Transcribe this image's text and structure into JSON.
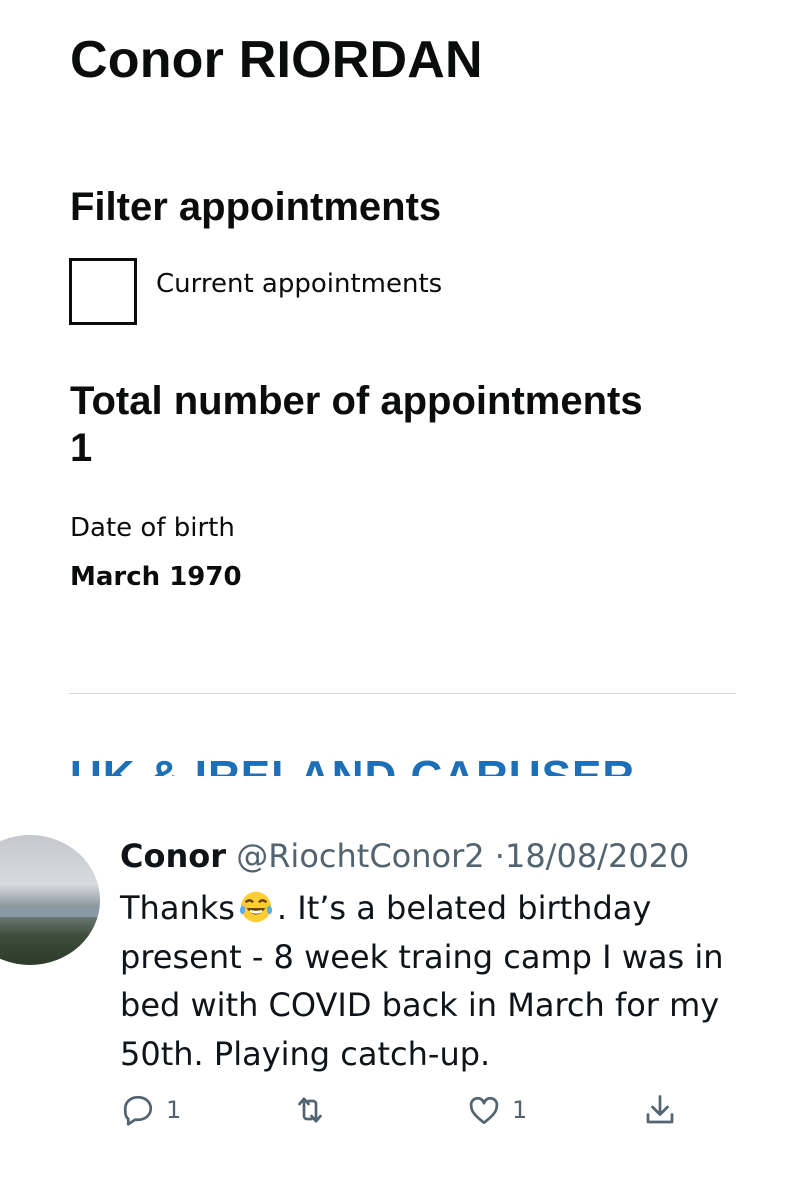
{
  "profile": {
    "name": "Conor RIORDAN",
    "filter_heading": "Filter appointments",
    "filter_checkbox_label": "Current appointments",
    "total_heading": "Total number of appointments",
    "total_count": "1",
    "dob_label": "Date of birth",
    "dob_value": "March 1970",
    "clipped_heading": "UK & IRELAND CARUSER"
  },
  "tweet": {
    "display_name": "Conor",
    "handle": "@RiochtConor2",
    "separator": "·",
    "date": "18/08/2020",
    "text_before_emoji": "Thanks",
    "emoji": "face-with-tears-of-joy",
    "text_after_emoji": ". It’s a belated birthday present - 8 week traing camp I was in bed with COVID back in March for my 50th. Playing catch-up.",
    "reply_count": "1",
    "like_count": "1"
  },
  "colors": {
    "text": "#0b0c0c",
    "link_blue": "#1d70b8",
    "tweet_meta": "#536471"
  }
}
